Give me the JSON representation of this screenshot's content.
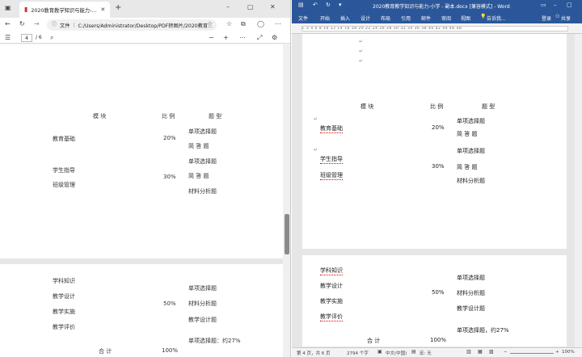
{
  "edge": {
    "tab_title": "2020教育教学知识与能力-小学 - 副本.pdf",
    "address_label": "文件",
    "address_path": "C:/Users/Administrator/Desktop/PDF转图片/2020教育...",
    "page_current": "4",
    "page_total": "/ 6",
    "page1": {
      "header_module": "模        块",
      "header_ratio": "比    例",
      "header_type": "题        型",
      "row1_module": "教育基础",
      "row1_ratio": "20%",
      "row1_type1": "单项选择题",
      "row1_type2": "简  答  题",
      "row2_module1": "学生指导",
      "row2_module2": "班级管理",
      "row2_ratio": "30%",
      "row2_type1": "单项选择题",
      "row2_type2": "简  答  题",
      "row2_type3": "材料分析题"
    },
    "page2": {
      "m1": "学科知识",
      "m2": "教学设计",
      "m3": "教学实施",
      "m4": "教学评价",
      "ratio": "50%",
      "t1": "单项选择题",
      "t2": "材料分析题",
      "t3": "教学设计题",
      "t4": "单项选择题：约27%",
      "total_label": "合    计",
      "total_ratio": "100%"
    }
  },
  "word": {
    "window_title": "2020教育教学知识与能力-小学 - 副本.docx [兼容模式] - Word",
    "menu": [
      "文件",
      "开始",
      "插入",
      "设计",
      "布局",
      "引用",
      "邮件",
      "审阅",
      "视图"
    ],
    "tell_me": "告诉我...",
    "login": "登录",
    "share": "共享",
    "ruler_scale": "L  2  4  6  8  10  12  14  16  18  20  22  24  26  28  30  32  34  36  38  40  42  44  46  48",
    "page1": {
      "header_module": "模        块",
      "header_ratio": "比    例",
      "header_type": "题        型",
      "row1_module": "教育基础",
      "row1_ratio": "20%",
      "row1_type1": "单项选择题",
      "row1_type2": "简  答  题",
      "row2_module1": "学生指导",
      "row2_module2": "班级管理",
      "row2_ratio": "30%",
      "row2_type1": "单项选择题",
      "row2_type2": "简  答  题",
      "row2_type3": "材料分析题"
    },
    "page2": {
      "m1": "学科知识",
      "m2": "教学设计",
      "m3": "教学实施",
      "m4": "教学评价",
      "ratio": "50%",
      "t1": "单项选择题",
      "t2": "材料分析题",
      "t3": "教学设计题",
      "t4": "单项选择题，约27%",
      "total_label": "合    计",
      "total_ratio": "100%"
    },
    "status": {
      "page": "第 4 页，共 6 页",
      "words": "2794 个字",
      "lang": "中文(中国)",
      "macro": "宏: 无",
      "zoom": "100%"
    },
    "colors": {
      "accent": "#2b579a"
    }
  }
}
